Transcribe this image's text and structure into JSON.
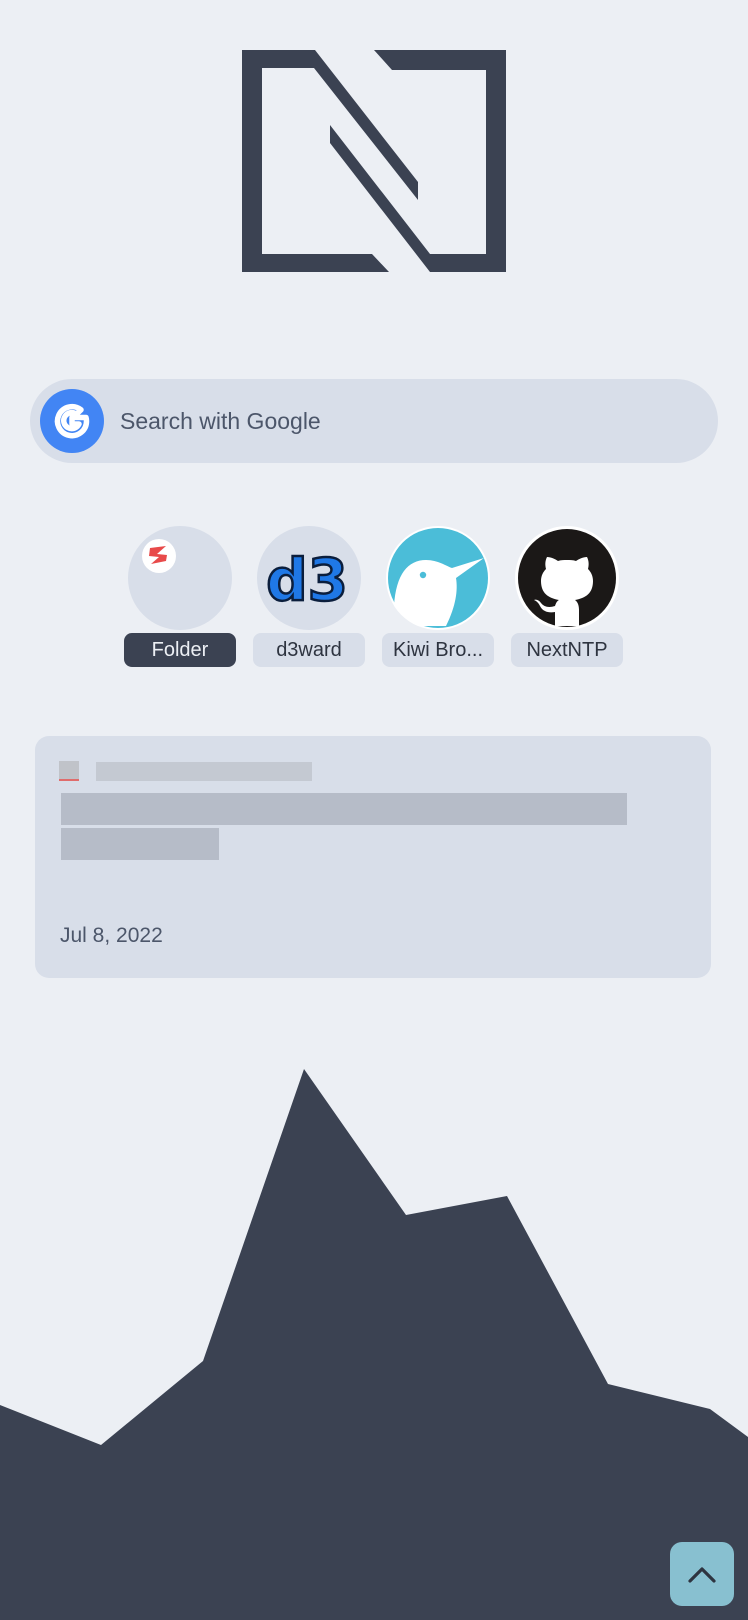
{
  "search": {
    "placeholder": "Search with Google",
    "engine_icon": "google-icon",
    "engine_color": "#4285f4"
  },
  "shortcuts": [
    {
      "label": "Folder",
      "icon": "folder-icon",
      "active": true
    },
    {
      "label": "d3ward",
      "icon": "d3-logo-icon"
    },
    {
      "label": "Kiwi Bro...",
      "icon": "kiwi-bird-icon"
    },
    {
      "label": "NextNTP",
      "icon": "github-icon"
    }
  ],
  "feed": {
    "date": "Jul 8, 2022"
  },
  "scroll_top": {
    "icon": "chevron-up-icon"
  },
  "colors": {
    "background": "#eceff4",
    "surface": "#d8dee9",
    "dark": "#3b4252",
    "accent": "#88c0d0"
  }
}
